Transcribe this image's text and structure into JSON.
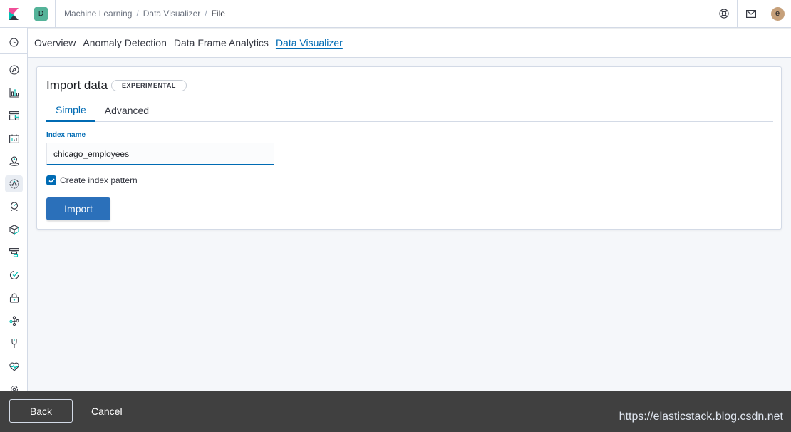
{
  "header": {
    "logo_icon": "kibana-logo-icon",
    "space_initial": "D",
    "breadcrumbs": [
      "Machine Learning",
      "Data Visualizer",
      "File"
    ],
    "help_icon": "help-lifebuoy-icon",
    "news_icon": "newsfeed-mail-icon",
    "user_initial": "e"
  },
  "nav_icons": [
    "recently-viewed-clock-icon",
    "discover-compass-icon",
    "visualize-chart-icon",
    "dashboard-icon",
    "canvas-icon",
    "maps-icon",
    "machine-learning-icon",
    "metrics-icon",
    "logs-icon",
    "apm-icon",
    "uptime-icon",
    "siem-icon",
    "graph-icon",
    "dev-tools-icon",
    "monitoring-icon",
    "management-gear-icon"
  ],
  "tabs": [
    {
      "label": "Overview"
    },
    {
      "label": "Anomaly Detection"
    },
    {
      "label": "Data Frame Analytics"
    },
    {
      "label": "Data Visualizer",
      "selected": true
    }
  ],
  "panel": {
    "title": "Import data",
    "badge": "EXPERIMENTAL",
    "tabs": [
      {
        "label": "Simple",
        "selected": true
      },
      {
        "label": "Advanced"
      }
    ],
    "index_label": "Index name",
    "index_value": "chicago_employees",
    "create_index_pattern_label": "Create index pattern",
    "create_index_pattern_checked": true,
    "import_label": "Import"
  },
  "bottom": {
    "back_label": "Back",
    "cancel_label": "Cancel"
  },
  "watermark": "https://elasticstack.blog.csdn.net",
  "colors": {
    "accent": "#006bb4",
    "primary_button": "#2b70ba",
    "space_avatar": "#54b399",
    "user_avatar": "#c6a07a",
    "bottom_bar": "#404040"
  }
}
